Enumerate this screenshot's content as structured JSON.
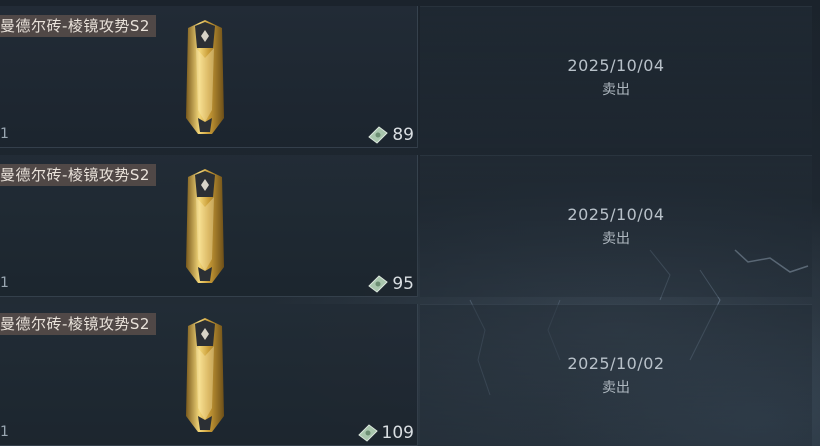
{
  "records": [
    {
      "item_name": "曼德尔砖-棱镜攻势S2",
      "quantity": "1",
      "price": "89",
      "date": "2025/10/04",
      "action": "卖出",
      "icon": "cash-icon"
    },
    {
      "item_name": "曼德尔砖-棱镜攻势S2",
      "quantity": "1",
      "price": "95",
      "date": "2025/10/04",
      "action": "卖出",
      "icon": "cash-icon"
    },
    {
      "item_name": "曼德尔砖-棱镜攻势S2",
      "quantity": "1",
      "price": "109",
      "date": "2025/10/02",
      "action": "卖出",
      "icon": "cash-icon"
    }
  ],
  "colors": {
    "name_tag_bg": "#78605688",
    "panel_bg": "#222c36",
    "text_primary": "#d9dee2",
    "text_secondary": "#b8c1c9",
    "item_gold": "#d9b24a"
  }
}
